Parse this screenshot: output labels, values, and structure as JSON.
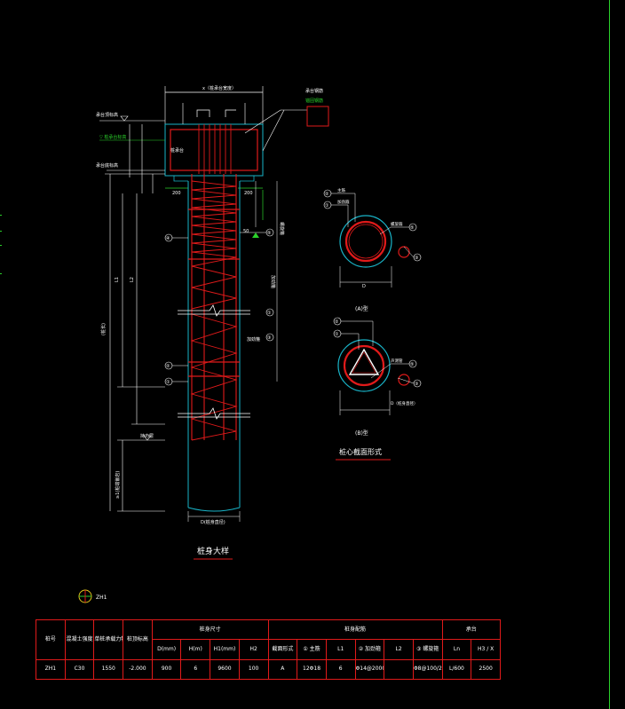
{
  "frame": {
    "accent": "#2bd12b",
    "rebar": "#e01a1a",
    "pile": "#19b4c8",
    "line": "#ffffff"
  },
  "drawing": {
    "detail_title": "桩身大样",
    "section_title": "桩心截面形式",
    "pile_label": "ZH1",
    "section_a_label": "(A)型",
    "section_b_label": "(B)型",
    "cap_width_label": "x（桩承台宽度）",
    "cap_note": "承台钢筋",
    "cap_tag": "桩承台",
    "anchor_note": "锚固钢筋",
    "elev_label": "承台顶标高",
    "elev_tag": "▽ 桩承台标高",
    "cap_bottom_label": "承台底标高",
    "spiral_note": "螺旋箍",
    "stirrup_note": "加劲箍",
    "len_label_1": "L1",
    "len_label_2": "L2",
    "len_label_3": "(桩长)",
    "rock_label": "持力层",
    "tip_label": "D(桩身直径)",
    "rock_depth_label": "≥1(桩端嵌岩)",
    "dim_200": "200",
    "dim_50": "50",
    "markers": [
      "①",
      "②",
      "③",
      "④",
      "⑤"
    ],
    "sec_a_labels": [
      "主筋",
      "加劲箍",
      "螺旋箍"
    ],
    "sec_b_labels": [
      "主筋",
      "加劲箍",
      "声测管"
    ],
    "sec_d_label": "D",
    "sec_b_d_label": "D（桩身直径）"
  },
  "table": {
    "head1": [
      "桩号",
      "混凝土强度",
      "单桩承载力特征值(kN)",
      "桩顶标高",
      "桩身尺寸",
      "",
      "",
      "",
      "桩身配筋",
      "",
      "",
      "",
      "",
      "",
      "承台",
      ""
    ],
    "head2": [
      "",
      "",
      "",
      "",
      "D(mm)",
      "H(m)",
      "H1(mm)",
      "H2",
      "截面形式",
      "① 主筋",
      "L1",
      "② 加劲箍",
      "L2",
      "③ 螺旋箍",
      "Ln",
      "H3 / X"
    ],
    "row": [
      "ZH1",
      "C30",
      "1550",
      "-2.000",
      "900",
      "6",
      "9600",
      "100",
      "A",
      "12Φ18",
      "6",
      "Φ14@2000",
      "",
      "Φ8@100/200",
      "L/600",
      "2500"
    ]
  }
}
